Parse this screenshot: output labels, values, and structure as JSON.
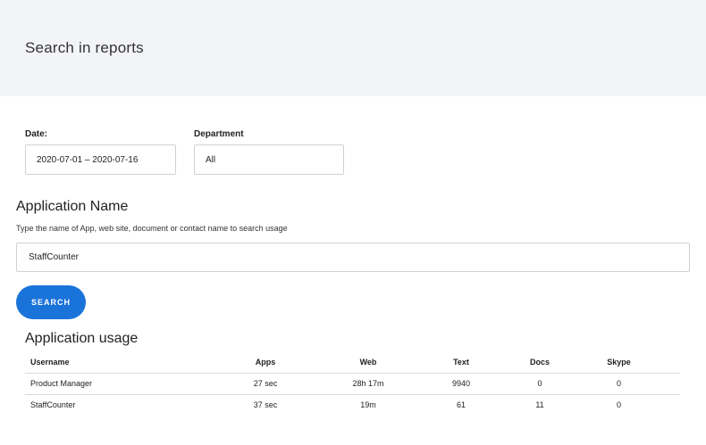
{
  "header": {
    "title": "Search in reports"
  },
  "filters": {
    "date": {
      "label": "Date:",
      "value": "2020-07-01 – 2020-07-16"
    },
    "department": {
      "label": "Department",
      "value": "All"
    }
  },
  "application_search": {
    "title": "Application Name",
    "hint": "Type the name of App, web site, document or contact name to search usage",
    "input_value": "StaffCounter",
    "button_label": "SEARCH"
  },
  "usage": {
    "title": "Application usage",
    "columns": [
      "Username",
      "Apps",
      "Web",
      "Text",
      "Docs",
      "Skype"
    ],
    "rows": [
      [
        "Product Manager",
        "27 sec",
        "28h 17m",
        "9940",
        "0",
        "0"
      ],
      [
        "StaffCounter",
        "37 sec",
        "19m",
        "61",
        "11",
        "0"
      ]
    ]
  },
  "colors": {
    "header_bg": "#f3f4f7",
    "accent": "#1a73d9",
    "border": "#cfd2d6"
  }
}
